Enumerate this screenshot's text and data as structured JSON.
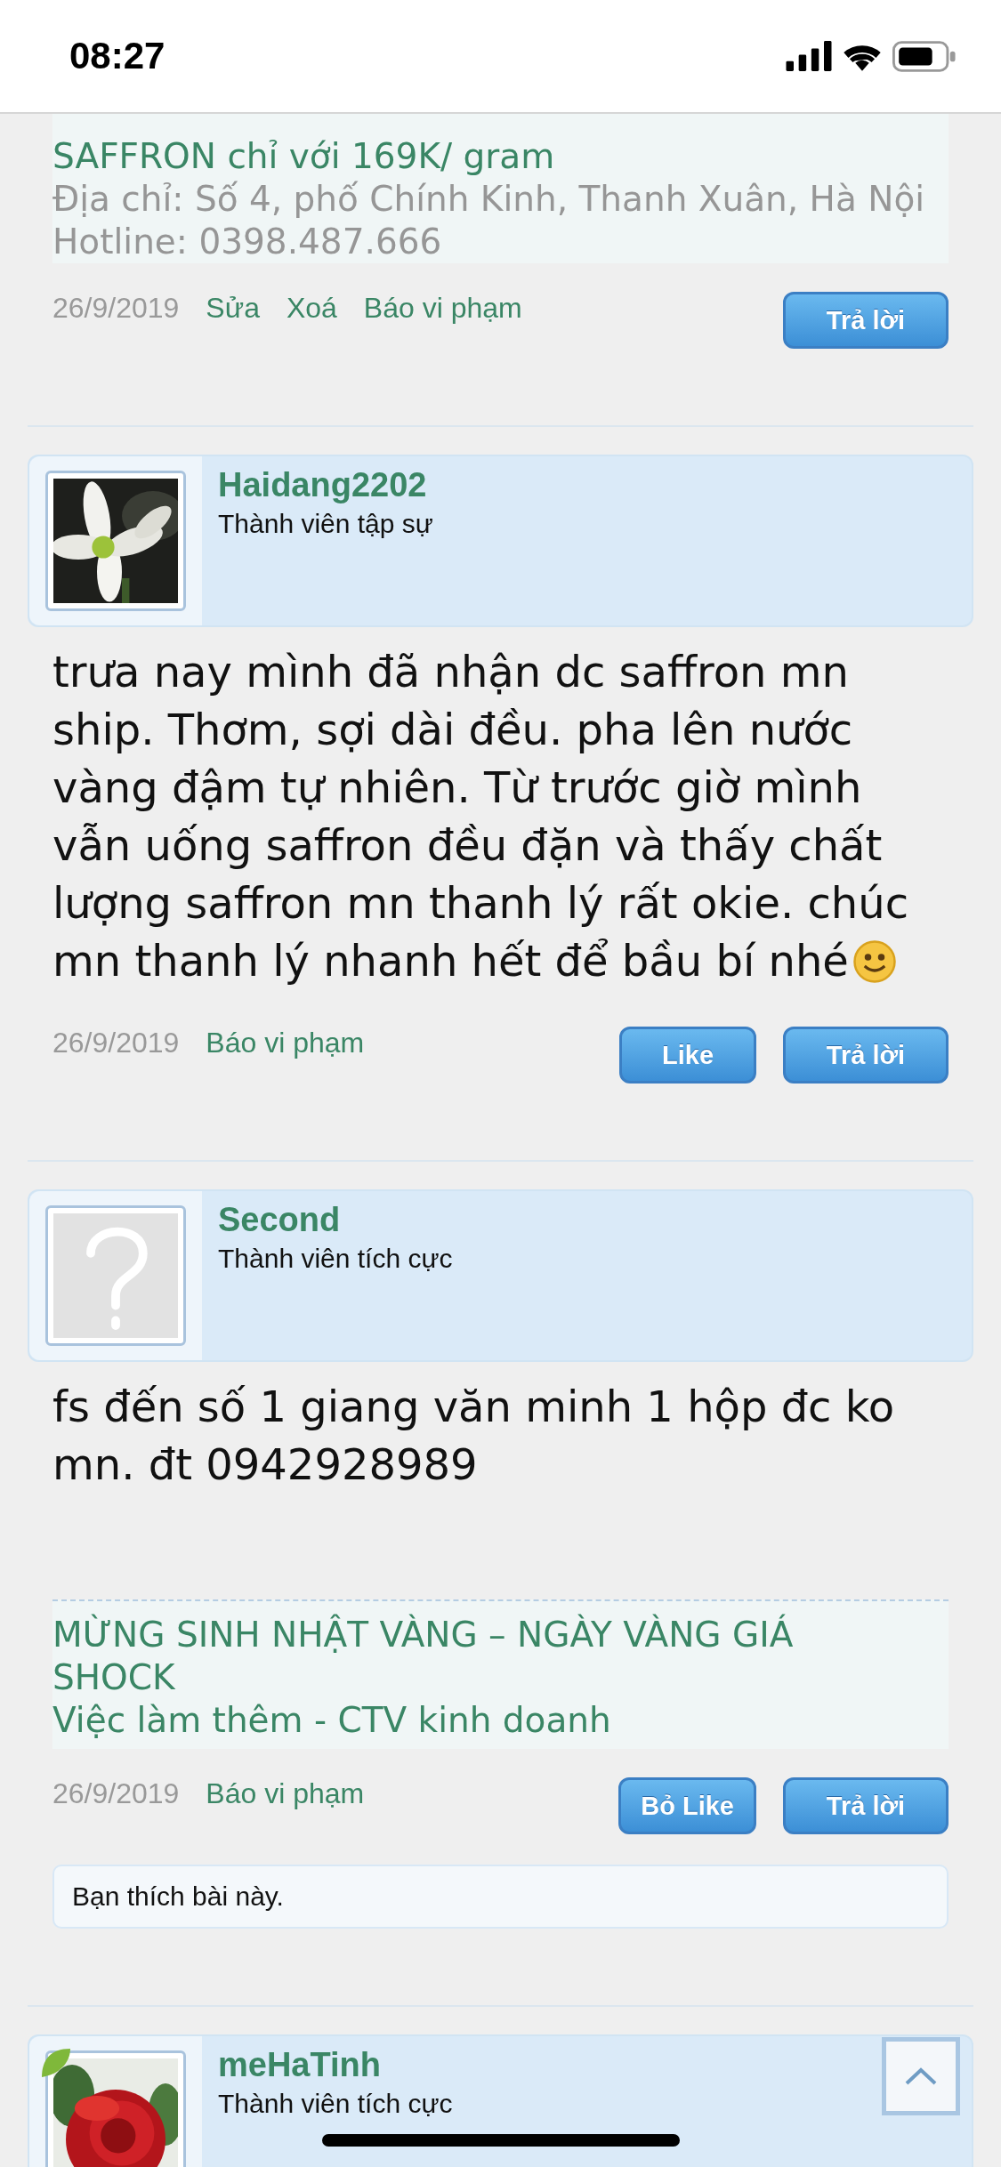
{
  "status_bar": {
    "time": "08:27"
  },
  "posts": [
    {
      "quote": [
        {
          "kind": "link",
          "text": "SAFFRON chỉ với 169K/ gram"
        },
        {
          "kind": "text",
          "text": "Địa chỉ: Số 4, phố Chính Kinh, Thanh Xuân, Hà Nội"
        },
        {
          "kind": "text",
          "text": "Hotline: 0398.487.666"
        }
      ],
      "quote_divider": false,
      "date": "26/9/2019",
      "links": [
        "Sửa",
        "Xoá",
        "Báo vi phạm"
      ],
      "buttons": [
        "Trả lời"
      ]
    },
    {
      "author": {
        "name": "Haidang2202",
        "rank": "Thành viên tập sự",
        "badge": false
      },
      "body": [
        "trưa nay mình đã nhận dc saffron mn",
        "ship. Thơm, sợi dài đều. pha lên nước",
        "vàng đậm tự nhiên. Từ trước giờ mình",
        "vẫn uống saffron đều đặn và thấy chất",
        "lượng saffron mn thanh lý rất okie. chúc",
        "mn thanh lý nhanh hết để bầu bí nhé"
      ],
      "emoji_end": true,
      "date": "26/9/2019",
      "links": [
        "Báo vi phạm"
      ],
      "buttons": [
        "Like",
        "Trả lời"
      ]
    },
    {
      "author": {
        "name": "Second",
        "rank": "Thành viên tích cực",
        "avatar": {
          "kind": "default"
        },
        "badge": false
      },
      "body": [
        "fs đến số 1 giang văn minh 1 hộp đc ko",
        "mn. đt 0942928989"
      ],
      "emoji_end": false,
      "quote": [
        {
          "kind": "link",
          "text": "MỪNG SINH NHẬT VÀNG – NGÀY VÀNG GIÁ"
        },
        {
          "kind": "link",
          "text": "SHOCK"
        },
        {
          "kind": "link",
          "text": "Việc làm thêm - CTV kinh doanh"
        }
      ],
      "quote_divider": true,
      "date": "26/9/2019",
      "links": [
        "Báo vi phạm"
      ],
      "buttons": [
        "Bỏ Like",
        "Trả lời"
      ],
      "like_notice": "Bạn thích bài này."
    },
    {
      "author": {
        "name": "meHaTinh",
        "rank": "Thành viên tích cực",
        "badge": true
      }
    }
  ]
}
